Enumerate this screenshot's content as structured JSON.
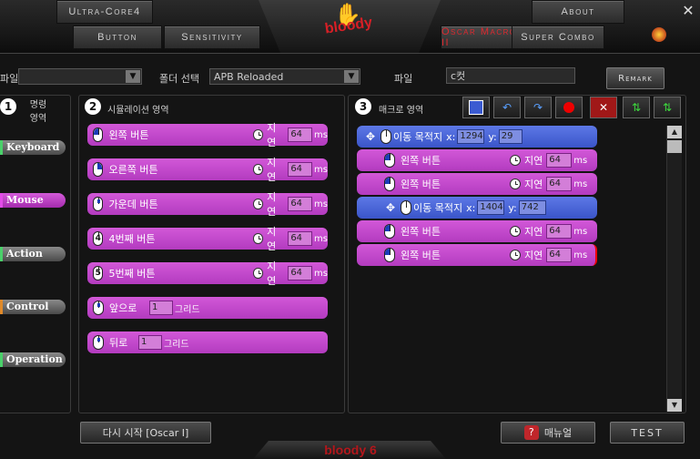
{
  "nav": {
    "ultra_core": "Ultra-Core4",
    "button": "Button",
    "sensitivity": "Sensitivity",
    "about": "About",
    "oscar_macro": "Oscar Macro II",
    "super_combo": "Super Combo",
    "logo": "bloody",
    "close": "✕"
  },
  "toolbar_row": {
    "file_left_label": "파일",
    "folder_label": "폴더 선택",
    "folder_value": "APB Reloaded",
    "file_label": "파일",
    "file_value": "c컷",
    "remark": "Remark"
  },
  "panel1": {
    "num": "1",
    "title_l1": "명령",
    "title_l2": "영역",
    "categories": [
      "Keyboard",
      "Mouse",
      "Action",
      "Control",
      "Operation"
    ]
  },
  "panel2": {
    "num": "2",
    "title": "시뮬레이션 영역",
    "delay_label": "지연",
    "ms": "ms",
    "blocks": [
      {
        "label": "왼쪽 버튼",
        "delay": "64",
        "icon": "mouse-left-icon"
      },
      {
        "label": "오른쪽 버튼",
        "delay": "64",
        "icon": "mouse-right-icon"
      },
      {
        "label": "가운데 버튼",
        "delay": "64",
        "icon": "mouse-middle-icon"
      },
      {
        "label": "4번째 버튼",
        "delay": "64",
        "icon": "mouse-button-4-icon"
      },
      {
        "label": "5번째 버튼",
        "delay": "64",
        "icon": "mouse-button-5-icon"
      }
    ],
    "scroll_blocks": [
      {
        "label": "앞으로",
        "value": "1",
        "unit": "그리드"
      },
      {
        "label": "뒤로",
        "value": "1",
        "unit": "그리드"
      }
    ],
    "restart_button": "다시 시작 [Oscar I]"
  },
  "panel3": {
    "num": "3",
    "title": "매크로 영역",
    "delay_label": "지연",
    "ms": "ms",
    "move": [
      {
        "label": "이동 목적지",
        "x_label": "x:",
        "x": "1294",
        "y_label": "y:",
        "y": "29"
      },
      {
        "label": "이동 목적지",
        "x_label": "x:",
        "x": "1404",
        "y_label": "y:",
        "y": "742"
      }
    ],
    "clicks": [
      {
        "label": "왼쪽 버튼",
        "delay": "64"
      },
      {
        "label": "왼쪽 버튼",
        "delay": "64"
      },
      {
        "label": "왼쪽 버튼",
        "delay": "64"
      },
      {
        "label": "왼쪽 버튼",
        "delay": "64"
      }
    ]
  },
  "footer": {
    "manual": "매뉴얼",
    "test": "TEST",
    "brand": "bloody 6"
  }
}
